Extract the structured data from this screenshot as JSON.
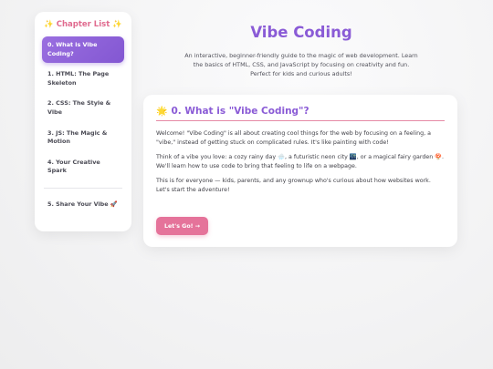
{
  "sidebar": {
    "title": "✨ Chapter List ✨",
    "items": [
      {
        "label": "0. What is Vibe Coding?",
        "active": true
      },
      {
        "label": "1. HTML: The Page Skeleton",
        "active": false
      },
      {
        "label": "2. CSS: The Style & Vibe",
        "active": false
      },
      {
        "label": "3. JS: The Magic & Motion",
        "active": false
      },
      {
        "label": "4. Your Creative Spark",
        "active": false
      },
      {
        "label": "5. Share Your Vibe 🚀",
        "active": false
      }
    ]
  },
  "header": {
    "title": "Vibe Coding",
    "subtitle": "An interactive, beginner-friendly guide to the magic of web development. Learn the basics of HTML, CSS, and JavaScript by focusing on creativity and fun. Perfect for kids and curious adults!"
  },
  "card": {
    "icon": "🌟",
    "heading": "0. What is \"Vibe Coding\"?",
    "paragraphs": [
      "Welcome! \"Vibe Coding\" is all about creating cool things for the web by focusing on a feeling, a \"vibe,\" instead of getting stuck on complicated rules. It's like painting with code!",
      "Think of a vibe you love: a cozy rainy day 🌧️, a futuristic neon city 🌃, or a magical fairy garden 🍄. We'll learn how to use code to bring that feeling to life on a webpage.",
      "This is for everyone — kids, parents, and any grownup who's curious about how websites work. Let's start the adventure!"
    ],
    "button_label": "Let's Go! →"
  },
  "colors": {
    "accent_purple": "#8a5bd6",
    "accent_pink": "#e5739a"
  }
}
